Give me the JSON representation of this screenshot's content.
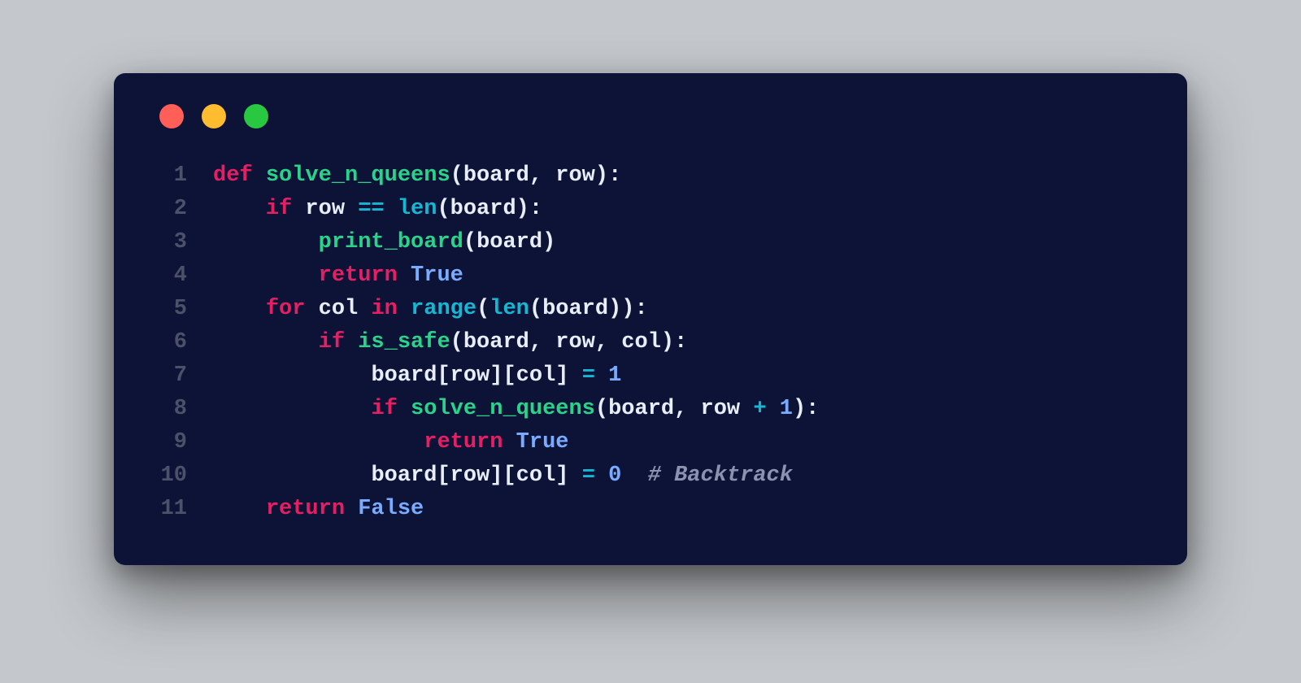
{
  "window": {
    "traffic_lights": [
      "close",
      "minimize",
      "zoom"
    ]
  },
  "code": {
    "language": "python",
    "lines": [
      {
        "num": "1",
        "tokens": [
          {
            "t": "def ",
            "c": "kw"
          },
          {
            "t": "solve_n_queens",
            "c": "fn"
          },
          {
            "t": "(",
            "c": "punc"
          },
          {
            "t": "board",
            "c": "id"
          },
          {
            "t": ", ",
            "c": "punc"
          },
          {
            "t": "row",
            "c": "id"
          },
          {
            "t": "):",
            "c": "punc"
          }
        ]
      },
      {
        "num": "2",
        "tokens": [
          {
            "t": "    ",
            "c": "punc"
          },
          {
            "t": "if ",
            "c": "kw"
          },
          {
            "t": "row ",
            "c": "id"
          },
          {
            "t": "== ",
            "c": "op"
          },
          {
            "t": "len",
            "c": "builtin"
          },
          {
            "t": "(",
            "c": "punc"
          },
          {
            "t": "board",
            "c": "id"
          },
          {
            "t": "):",
            "c": "punc"
          }
        ]
      },
      {
        "num": "3",
        "tokens": [
          {
            "t": "        ",
            "c": "punc"
          },
          {
            "t": "print_board",
            "c": "fn"
          },
          {
            "t": "(",
            "c": "punc"
          },
          {
            "t": "board",
            "c": "id"
          },
          {
            "t": ")",
            "c": "punc"
          }
        ]
      },
      {
        "num": "4",
        "tokens": [
          {
            "t": "        ",
            "c": "punc"
          },
          {
            "t": "return ",
            "c": "kw"
          },
          {
            "t": "True",
            "c": "bool"
          }
        ]
      },
      {
        "num": "5",
        "tokens": [
          {
            "t": "    ",
            "c": "punc"
          },
          {
            "t": "for ",
            "c": "kw"
          },
          {
            "t": "col ",
            "c": "id"
          },
          {
            "t": "in ",
            "c": "kw"
          },
          {
            "t": "range",
            "c": "builtin"
          },
          {
            "t": "(",
            "c": "punc"
          },
          {
            "t": "len",
            "c": "builtin"
          },
          {
            "t": "(",
            "c": "punc"
          },
          {
            "t": "board",
            "c": "id"
          },
          {
            "t": ")):",
            "c": "punc"
          }
        ]
      },
      {
        "num": "6",
        "tokens": [
          {
            "t": "        ",
            "c": "punc"
          },
          {
            "t": "if ",
            "c": "kw"
          },
          {
            "t": "is_safe",
            "c": "fn"
          },
          {
            "t": "(",
            "c": "punc"
          },
          {
            "t": "board",
            "c": "id"
          },
          {
            "t": ", ",
            "c": "punc"
          },
          {
            "t": "row",
            "c": "id"
          },
          {
            "t": ", ",
            "c": "punc"
          },
          {
            "t": "col",
            "c": "id"
          },
          {
            "t": "):",
            "c": "punc"
          }
        ]
      },
      {
        "num": "7",
        "tokens": [
          {
            "t": "            ",
            "c": "punc"
          },
          {
            "t": "board",
            "c": "id"
          },
          {
            "t": "[",
            "c": "punc"
          },
          {
            "t": "row",
            "c": "id"
          },
          {
            "t": "][",
            "c": "punc"
          },
          {
            "t": "col",
            "c": "id"
          },
          {
            "t": "] ",
            "c": "punc"
          },
          {
            "t": "= ",
            "c": "op"
          },
          {
            "t": "1",
            "c": "num"
          }
        ]
      },
      {
        "num": "8",
        "tokens": [
          {
            "t": "            ",
            "c": "punc"
          },
          {
            "t": "if ",
            "c": "kw"
          },
          {
            "t": "solve_n_queens",
            "c": "fn"
          },
          {
            "t": "(",
            "c": "punc"
          },
          {
            "t": "board",
            "c": "id"
          },
          {
            "t": ", ",
            "c": "punc"
          },
          {
            "t": "row ",
            "c": "id"
          },
          {
            "t": "+ ",
            "c": "op"
          },
          {
            "t": "1",
            "c": "num"
          },
          {
            "t": "):",
            "c": "punc"
          }
        ]
      },
      {
        "num": "9",
        "tokens": [
          {
            "t": "                ",
            "c": "punc"
          },
          {
            "t": "return ",
            "c": "kw"
          },
          {
            "t": "True",
            "c": "bool"
          }
        ]
      },
      {
        "num": "10",
        "tokens": [
          {
            "t": "            ",
            "c": "punc"
          },
          {
            "t": "board",
            "c": "id"
          },
          {
            "t": "[",
            "c": "punc"
          },
          {
            "t": "row",
            "c": "id"
          },
          {
            "t": "][",
            "c": "punc"
          },
          {
            "t": "col",
            "c": "id"
          },
          {
            "t": "] ",
            "c": "punc"
          },
          {
            "t": "= ",
            "c": "op"
          },
          {
            "t": "0",
            "c": "num"
          },
          {
            "t": "  ",
            "c": "punc"
          },
          {
            "t": "# Backtrack",
            "c": "comment"
          }
        ]
      },
      {
        "num": "11",
        "tokens": [
          {
            "t": "    ",
            "c": "punc"
          },
          {
            "t": "return ",
            "c": "kw"
          },
          {
            "t": "False",
            "c": "bool"
          }
        ]
      }
    ]
  }
}
